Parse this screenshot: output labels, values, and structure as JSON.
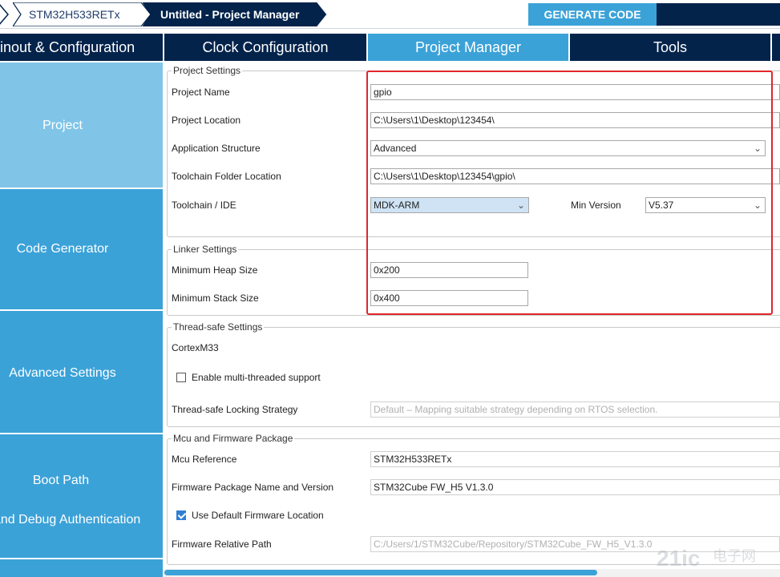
{
  "breadcrumb": {
    "device": "STM32H533RETx",
    "project": "Untitled - Project Manager"
  },
  "toolbar": {
    "generate_label": "GENERATE CODE"
  },
  "tabs": [
    {
      "label": "Pinout & Configuration",
      "active": false
    },
    {
      "label": "Clock Configuration",
      "active": false
    },
    {
      "label": "Project Manager",
      "active": true
    },
    {
      "label": "Tools",
      "active": false
    }
  ],
  "sidebar": {
    "items": [
      {
        "label": "Project",
        "active": true
      },
      {
        "label": "Code Generator",
        "active": false
      },
      {
        "label": "Advanced Settings",
        "active": false
      },
      {
        "label": "Boot Path",
        "label2": "and Debug Authentication",
        "active": false
      }
    ]
  },
  "project_settings": {
    "title": "Project Settings",
    "name_label": "Project Name",
    "name_value": "gpio",
    "location_label": "Project Location",
    "location_value": "C:\\Users\\1\\Desktop\\123454\\",
    "structure_label": "Application Structure",
    "structure_value": "Advanced",
    "toolchain_folder_label": "Toolchain Folder Location",
    "toolchain_folder_value": "C:\\Users\\1\\Desktop\\123454\\gpio\\",
    "toolchain_label": "Toolchain / IDE",
    "toolchain_value": "MDK-ARM",
    "min_version_label": "Min Version",
    "min_version_value": "V5.37"
  },
  "linker_settings": {
    "title": "Linker Settings",
    "heap_label": "Minimum Heap Size",
    "heap_value": "0x200",
    "stack_label": "Minimum Stack Size",
    "stack_value": "0x400"
  },
  "thread_safe": {
    "title": "Thread-safe Settings",
    "core": "CortexM33",
    "multi_thread_label": "Enable multi-threaded support",
    "multi_thread_checked": false,
    "strategy_label": "Thread-safe Locking Strategy",
    "strategy_value": "Default  –  Mapping suitable strategy depending on RTOS selection."
  },
  "mcu_firmware": {
    "title": "Mcu and Firmware Package",
    "mcu_ref_label": "Mcu Reference",
    "mcu_ref_value": "STM32H533RETx",
    "fw_name_label": "Firmware Package Name and Version",
    "fw_name_value": "STM32Cube FW_H5 V1.3.0",
    "use_default_label": "Use Default Firmware Location",
    "use_default_checked": true,
    "fw_path_label": "Firmware Relative Path",
    "fw_path_value": "C:/Users/1/STM32Cube/Repository/STM32Cube_FW_H5_V1.3.0"
  },
  "colors": {
    "navy": "#03234b",
    "accent_blue": "#3ba2d8",
    "sidebar_active": "#80c5e8",
    "highlight_red": "#e0262b"
  },
  "icons": {
    "combo_arrow": "chevron-down-icon",
    "breadcrumb_separator": "chevron-right-icon"
  },
  "watermark": {
    "text": "21ic 电子网"
  }
}
